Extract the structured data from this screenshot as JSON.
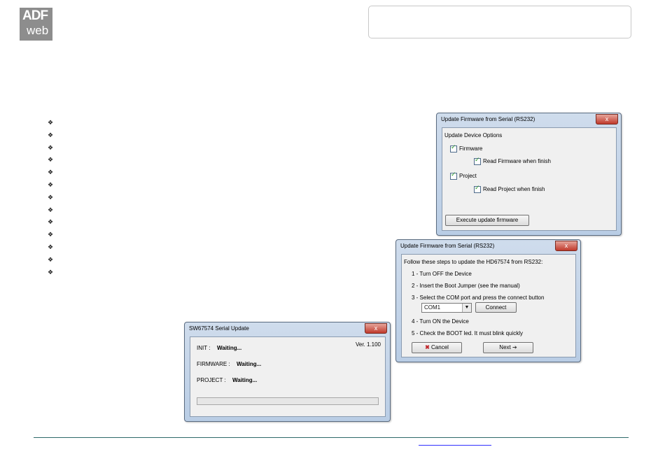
{
  "logo": {
    "line1": "ADF",
    "line2": "web"
  },
  "bullets_count": 13,
  "dialog_options": {
    "title": "Update Firmware from Serial (RS232)",
    "close": "x",
    "group_label": "Update Device Options",
    "firmware_label": "Firmware",
    "read_firmware_label": "Read Firmware when finish",
    "project_label": "Project",
    "read_project_label": "Read Project when finish",
    "execute_button": "Execute update firmware"
  },
  "dialog_steps": {
    "title": "Update Firmware from Serial (RS232)",
    "close": "x",
    "intro": "Follow these steps to update the HD67574 from RS232:",
    "step1": "1 - Turn OFF the Device",
    "step2": "2 - Insert the Boot Jumper (see the manual)",
    "step3": "3 - Select the  COM port and press the connect button",
    "com_value": "COM1",
    "connect_button": "Connect",
    "step4": "4 - Turn ON the Device",
    "step5": "5 - Check the BOOT led. It must blink quickly",
    "cancel_button": "Cancel",
    "next_button": "Next"
  },
  "dialog_serial": {
    "title": "SW67574 Serial Update",
    "close": "x",
    "version": "Ver. 1.100",
    "init_label": "INIT :",
    "init_status": "Waiting...",
    "firmware_label": "FIRMWARE :",
    "firmware_status": "Waiting...",
    "project_label": "PROJECT :",
    "project_status": "Waiting...",
    "progress": 0
  }
}
